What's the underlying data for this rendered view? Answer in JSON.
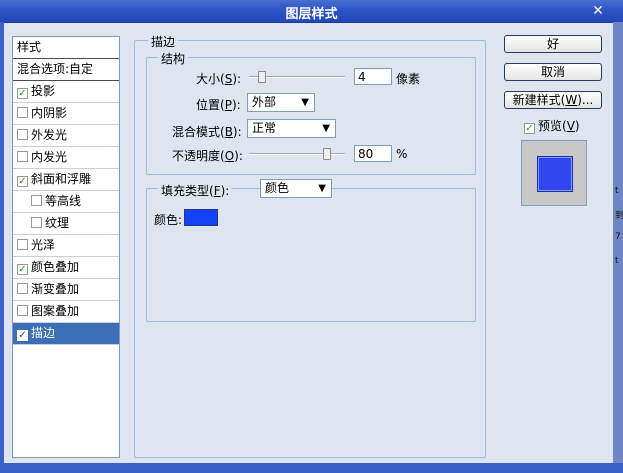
{
  "window": {
    "title": "图层样式",
    "close_glyph": "✕"
  },
  "styles_list": {
    "header": "样式",
    "blend_options": "混合选项:自定",
    "items": [
      {
        "label": "投影",
        "checked": true,
        "indent": false,
        "selected": false
      },
      {
        "label": "内阴影",
        "checked": false,
        "indent": false,
        "selected": false
      },
      {
        "label": "外发光",
        "checked": false,
        "indent": false,
        "selected": false
      },
      {
        "label": "内发光",
        "checked": false,
        "indent": false,
        "selected": false
      },
      {
        "label": "斜面和浮雕",
        "checked": true,
        "indent": false,
        "selected": false
      },
      {
        "label": "等高线",
        "checked": false,
        "indent": true,
        "selected": false
      },
      {
        "label": "纹理",
        "checked": false,
        "indent": true,
        "selected": false
      },
      {
        "label": "光泽",
        "checked": false,
        "indent": false,
        "selected": false
      },
      {
        "label": "颜色叠加",
        "checked": true,
        "indent": false,
        "selected": false
      },
      {
        "label": "渐变叠加",
        "checked": false,
        "indent": false,
        "selected": false
      },
      {
        "label": "图案叠加",
        "checked": false,
        "indent": false,
        "selected": false
      },
      {
        "label": "描边",
        "checked": true,
        "indent": false,
        "selected": true
      }
    ]
  },
  "stroke": {
    "group_title": "描边",
    "structure_title": "结构",
    "size_label": "大小(S):",
    "size_value": "4",
    "size_unit": "像素",
    "position_label": "位置(P):",
    "position_value": "外部",
    "blend_mode_label": "混合模式(B):",
    "blend_mode_value": "正常",
    "opacity_label": "不透明度(O):",
    "opacity_value": "80",
    "opacity_unit": "%",
    "fill_type_label": "填充类型(F):",
    "fill_type_value": "颜色",
    "color_label": "颜色:",
    "color_hex": "#1441f5"
  },
  "buttons": {
    "ok": "好",
    "cancel": "取消",
    "new_style": "新建样式(W)..."
  },
  "preview": {
    "label": "预览(V)",
    "checked": true
  },
  "right_edge_text": [
    "t",
    "到",
    "7",
    "t"
  ]
}
